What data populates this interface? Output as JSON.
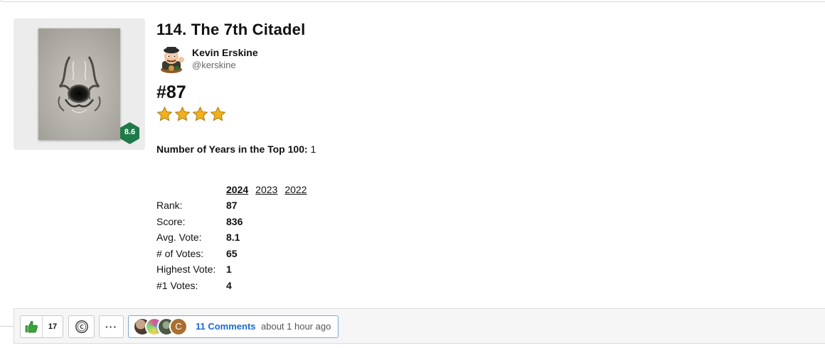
{
  "album": {
    "title": "114. The 7th Citadel",
    "user_rating": "8.6",
    "rank": "#87",
    "stars": 4,
    "years_label": "Number of Years in the Top 100:",
    "years_value": "1"
  },
  "author": {
    "name": "Kevin Erskine",
    "handle": "@kerskine"
  },
  "year_tabs": [
    "2024",
    "2023",
    "2022"
  ],
  "active_year": "2024",
  "stats": [
    {
      "label": "Rank:",
      "value": "87"
    },
    {
      "label": "Score:",
      "value": "836"
    },
    {
      "label": "Avg. Vote:",
      "value": "8.1"
    },
    {
      "label": "# of Votes:",
      "value": "65"
    },
    {
      "label": "Highest Vote:",
      "value": "1"
    },
    {
      "label": "#1 Votes:",
      "value": "4"
    }
  ],
  "footer": {
    "like_count": "17",
    "more_label": "···",
    "comments_label": "11 Comments",
    "comments_time": "about 1 hour ago",
    "commenter_initial": "C"
  },
  "colors": {
    "rating_badge": "#1f7a4a",
    "link": "#1a6ad2",
    "star": "#f2b01e",
    "thumb": "#3aa43a"
  }
}
